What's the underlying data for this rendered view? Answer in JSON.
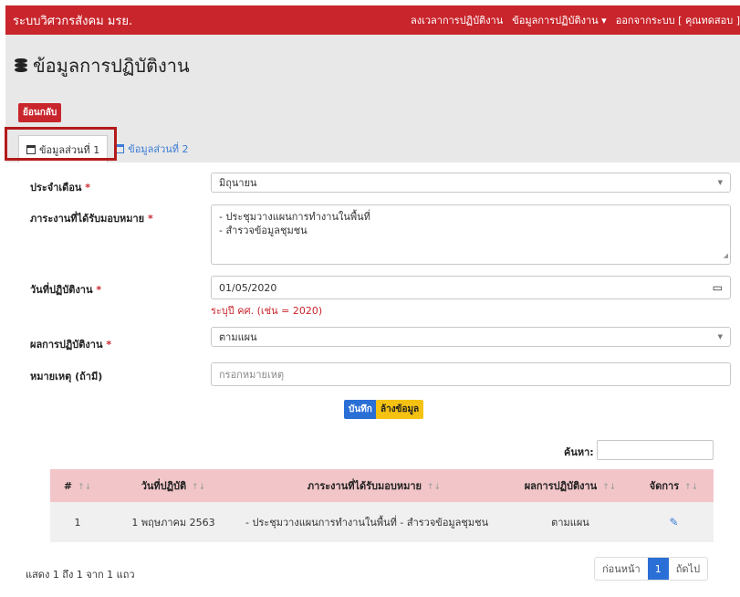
{
  "navbar": {
    "brand": "ระบบวิศวกรสังคม มรย.",
    "links": [
      "ลงเวลาการปฏิบัติงาน",
      "ข้อมูลการปฏิบัติงาน ▾",
      "ออกจากระบบ [ คุณทดสอบ ]"
    ]
  },
  "page": {
    "title": "ข้อมูลการปฏิบัติงาน",
    "back_label": "ย้อนกลับ"
  },
  "tabs": [
    {
      "label": "ข้อมูลส่วนที่ 1"
    },
    {
      "label": "ข้อมูลส่วนที่ 2"
    }
  ],
  "form": {
    "month": {
      "label": "ประจำเดือน",
      "value": "มิถุนายน"
    },
    "task": {
      "label": "ภาระงานที่ได้รับมอบหมาย",
      "lines": [
        "- ประชุมวางแผนการทำงานในพื้นที่",
        "- สำรวจข้อมูลชุมชน"
      ]
    },
    "date": {
      "label": "วันที่ปฏิบัติงาน",
      "value": "01/05/2020",
      "hint": "ระบุปี คศ. (เช่น = 2020)"
    },
    "result": {
      "label": "ผลการปฏิบัติงาน",
      "value": "ตามแผน"
    },
    "note": {
      "label": "หมายเหตุ (ถ้ามี)",
      "placeholder": "กรอกหมายเหตุ"
    },
    "required_mark": "*",
    "save_label": "บันทึก",
    "clear_label": "ล้างข้อมูล"
  },
  "table": {
    "search_label": "ค้นหา:",
    "headers": [
      "#",
      "วันที่ปฏิบัติ",
      "ภาระงานที่ได้รับมอบหมาย",
      "ผลการปฏิบัติงาน",
      "จัดการ"
    ],
    "sort_glyph": "↑↓",
    "rows": [
      {
        "num": "1",
        "date": "1 พฤษภาคม 2563",
        "task": "- ประชุมวางแผนการทำงานในพื้นที่ - สำรวจข้อมูลชุมชน",
        "result": "ตามแผน"
      }
    ],
    "info": "แสดง 1 ถึง 1 จาก 1 แถว",
    "pager": {
      "prev": "ก่อนหน้า",
      "page": "1",
      "next": "ถัดไป"
    }
  },
  "colors": {
    "brand": "#c9252c",
    "primary": "#2a6fd6",
    "warning": "#f5c211",
    "header_row": "#f2c6c9"
  }
}
